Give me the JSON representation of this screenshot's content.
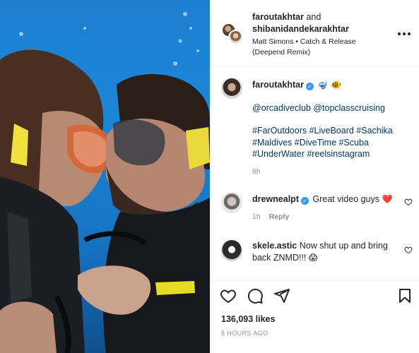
{
  "post": {
    "header": {
      "user1": "faroutakhtar",
      "and_text": "and",
      "user2": "shibanidandekarakhtar",
      "music": "Matt Simons • Catch & Release (Deepend Remix)"
    },
    "caption": {
      "username": "faroutakhtar",
      "emojis": "🤿 🐠",
      "mentions": "@orcadiveclub @topclasscruising",
      "hashtags": "#FarOutdoors #LiveBoard #Sachika #Maldives #DiveTime #Scuba #UnderWater #reelsinstagram",
      "time": "8h"
    },
    "comments": [
      {
        "username": "drewnealpt",
        "text": "Great video guys",
        "emoji": "❤️",
        "time": "1h",
        "reply_label": "Reply"
      },
      {
        "username": "skele.astic",
        "text": "Now shut up and bring back ZNMD!!!",
        "emoji": "😱"
      }
    ],
    "likes": "136,093 likes",
    "posted": "8 HOURS AGO"
  },
  "icons": [
    "more-options-icon",
    "verified-badge-icon",
    "heart-icon",
    "comment-icon",
    "share-icon",
    "bookmark-icon"
  ],
  "colors": {
    "verified": "#3897f0",
    "hashtag": "#00376b",
    "muted": "#8e8e8e",
    "text": "#262626"
  }
}
